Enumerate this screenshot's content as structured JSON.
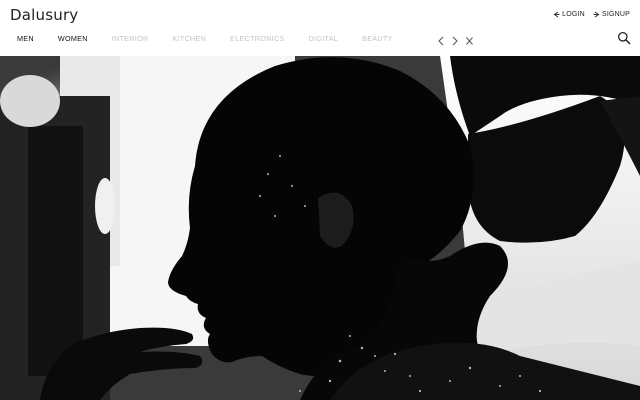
{
  "brand": {
    "logo_text": "Dalusury"
  },
  "account": {
    "login_label": "LOGIN",
    "signup_label": "SIGNUP"
  },
  "nav": {
    "items": [
      {
        "label": "MEN",
        "active": true
      },
      {
        "label": "WOMEN",
        "active": true
      },
      {
        "label": "INTERIOR",
        "active": false
      },
      {
        "label": "KITCHEN",
        "active": false
      },
      {
        "label": "ELECTRONICS",
        "active": false
      },
      {
        "label": "DIGITAL",
        "active": false
      },
      {
        "label": "BEAUTY",
        "active": false
      }
    ],
    "icons": [
      "chevron-left-icon",
      "chevron-right-icon",
      "close-icon"
    ]
  },
  "colors": {
    "active_nav": "#111111",
    "inactive_nav": "#c4c4c4",
    "header_bg": "#ffffff",
    "hero_bg": "#0e0e0e"
  },
  "hero": {
    "image_semantic": "black-and-white portrait of woman in profile with large hair bow"
  }
}
